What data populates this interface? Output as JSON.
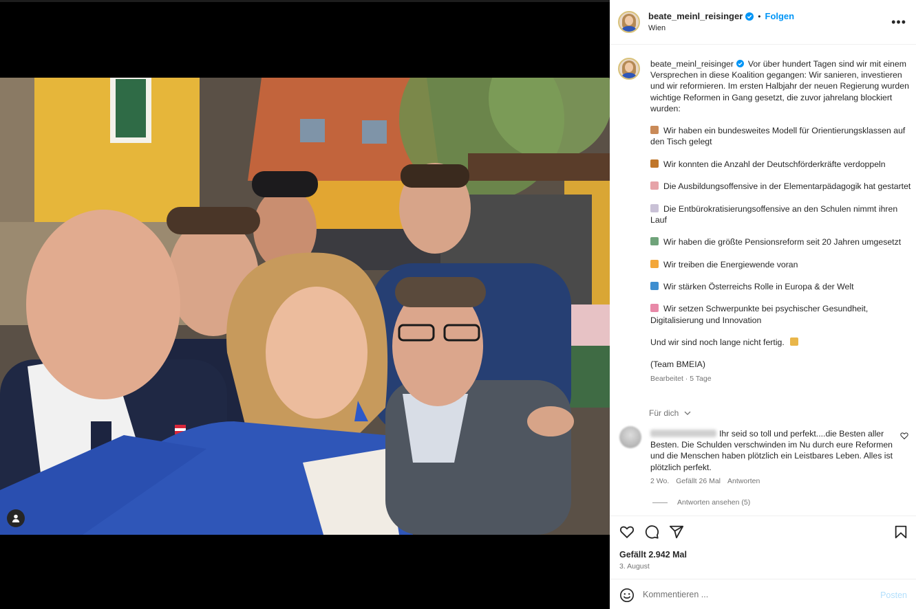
{
  "post": {
    "username": "beate_meinl_reisinger",
    "follow_label": "Folgen",
    "location": "Wien",
    "more_icon": "more-horizontal-icon",
    "caption": {
      "intro": "Vor über hundert Tagen sind wir mit einem Versprechen in diese Koalition gegangen: Wir sanieren, investieren und wir reformieren. Im ersten Halbjahr der neuen Regierung wurden wichtige Reformen in Gang gesetzt, die zuvor jahrelang blockiert wurden:",
      "bullets": [
        {
          "emoji": "school-emoji",
          "color": "#c98a58",
          "text": "Wir haben ein bundesweites Modell für Orientierungsklassen auf den Tisch gelegt"
        },
        {
          "emoji": "teacher-emoji",
          "color": "#c0762a",
          "text": "Wir konnten die Anzahl der Deutschförderkräfte verdoppeln"
        },
        {
          "emoji": "crayon-emoji",
          "color": "#e6a3a8",
          "text": "Die Ausbildungsoffensive in der Elementarpädagogik hat gestartet"
        },
        {
          "emoji": "memo-emoji",
          "color": "#c9c1d6",
          "text": "Die Entbürokratisierungsoffensive an den Schulen nimmt ihren Lauf"
        },
        {
          "emoji": "money-emoji",
          "color": "#6fa37a",
          "text": "Wir haben die größte Pensionsreform seit 20 Jahren umgesetzt"
        },
        {
          "emoji": "lightning-emoji",
          "color": "#f3a73a",
          "text": "Wir treiben die Energiewende voran"
        },
        {
          "emoji": "globe-emoji",
          "color": "#3f8fd0",
          "text": "Wir stärken Österreichs Rolle in Europa & der Welt"
        },
        {
          "emoji": "brain-emoji",
          "color": "#e889a8",
          "text": "Wir setzen Schwerpunkte bei psychischer Gesundheit, Digitalisierung und Innovation"
        }
      ],
      "closing": "Und wir sind noch lange nicht fertig.",
      "closing_emoji": {
        "emoji": "party-emoji",
        "color": "#e9b64a"
      },
      "signature": "(Team BMEIA)",
      "meta": "Bearbeitet · 5 Tage"
    },
    "for_you_label": "Für dich",
    "comment": {
      "text": "Ihr seid so toll und perfekt....die Besten aller Besten. Die Schulden verschwinden im Nu durch eure Reformen und die Menschen haben plötzlich ein Leistbares Leben. Alles ist plötzlich perfekt.",
      "age": "2 Wo.",
      "likes": "Gefällt 26 Mal",
      "reply_label": "Antworten",
      "view_replies": "Antworten ansehen (5)"
    },
    "likes_text": "Gefällt 2.942 Mal",
    "date": "3. August",
    "comment_placeholder": "Kommentieren ...",
    "post_label": "Posten",
    "colors": {
      "accent": "#0095f6",
      "post_disabled": "#b2dffc",
      "muted": "#737373"
    }
  }
}
